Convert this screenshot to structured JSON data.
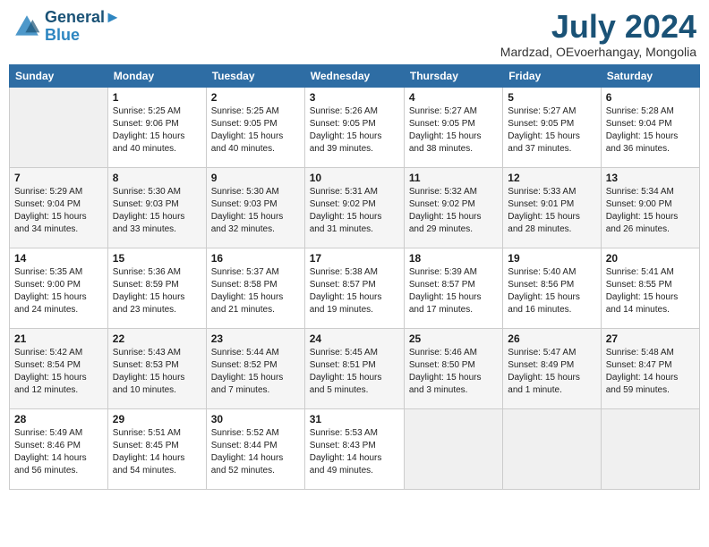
{
  "header": {
    "logo_line1": "General",
    "logo_line2": "Blue",
    "month": "July 2024",
    "location": "Mardzad, OEvoerhangay, Mongolia"
  },
  "weekdays": [
    "Sunday",
    "Monday",
    "Tuesday",
    "Wednesday",
    "Thursday",
    "Friday",
    "Saturday"
  ],
  "weeks": [
    [
      {
        "day": "",
        "empty": true
      },
      {
        "day": "1",
        "sunrise": "5:25 AM",
        "sunset": "9:06 PM",
        "daylight": "15 hours and 40 minutes."
      },
      {
        "day": "2",
        "sunrise": "5:25 AM",
        "sunset": "9:05 PM",
        "daylight": "15 hours and 40 minutes."
      },
      {
        "day": "3",
        "sunrise": "5:26 AM",
        "sunset": "9:05 PM",
        "daylight": "15 hours and 39 minutes."
      },
      {
        "day": "4",
        "sunrise": "5:27 AM",
        "sunset": "9:05 PM",
        "daylight": "15 hours and 38 minutes."
      },
      {
        "day": "5",
        "sunrise": "5:27 AM",
        "sunset": "9:05 PM",
        "daylight": "15 hours and 37 minutes."
      },
      {
        "day": "6",
        "sunrise": "5:28 AM",
        "sunset": "9:04 PM",
        "daylight": "15 hours and 36 minutes."
      }
    ],
    [
      {
        "day": "7",
        "sunrise": "5:29 AM",
        "sunset": "9:04 PM",
        "daylight": "15 hours and 34 minutes."
      },
      {
        "day": "8",
        "sunrise": "5:30 AM",
        "sunset": "9:03 PM",
        "daylight": "15 hours and 33 minutes."
      },
      {
        "day": "9",
        "sunrise": "5:30 AM",
        "sunset": "9:03 PM",
        "daylight": "15 hours and 32 minutes."
      },
      {
        "day": "10",
        "sunrise": "5:31 AM",
        "sunset": "9:02 PM",
        "daylight": "15 hours and 31 minutes."
      },
      {
        "day": "11",
        "sunrise": "5:32 AM",
        "sunset": "9:02 PM",
        "daylight": "15 hours and 29 minutes."
      },
      {
        "day": "12",
        "sunrise": "5:33 AM",
        "sunset": "9:01 PM",
        "daylight": "15 hours and 28 minutes."
      },
      {
        "day": "13",
        "sunrise": "5:34 AM",
        "sunset": "9:00 PM",
        "daylight": "15 hours and 26 minutes."
      }
    ],
    [
      {
        "day": "14",
        "sunrise": "5:35 AM",
        "sunset": "9:00 PM",
        "daylight": "15 hours and 24 minutes."
      },
      {
        "day": "15",
        "sunrise": "5:36 AM",
        "sunset": "8:59 PM",
        "daylight": "15 hours and 23 minutes."
      },
      {
        "day": "16",
        "sunrise": "5:37 AM",
        "sunset": "8:58 PM",
        "daylight": "15 hours and 21 minutes."
      },
      {
        "day": "17",
        "sunrise": "5:38 AM",
        "sunset": "8:57 PM",
        "daylight": "15 hours and 19 minutes."
      },
      {
        "day": "18",
        "sunrise": "5:39 AM",
        "sunset": "8:57 PM",
        "daylight": "15 hours and 17 minutes."
      },
      {
        "day": "19",
        "sunrise": "5:40 AM",
        "sunset": "8:56 PM",
        "daylight": "15 hours and 16 minutes."
      },
      {
        "day": "20",
        "sunrise": "5:41 AM",
        "sunset": "8:55 PM",
        "daylight": "15 hours and 14 minutes."
      }
    ],
    [
      {
        "day": "21",
        "sunrise": "5:42 AM",
        "sunset": "8:54 PM",
        "daylight": "15 hours and 12 minutes."
      },
      {
        "day": "22",
        "sunrise": "5:43 AM",
        "sunset": "8:53 PM",
        "daylight": "15 hours and 10 minutes."
      },
      {
        "day": "23",
        "sunrise": "5:44 AM",
        "sunset": "8:52 PM",
        "daylight": "15 hours and 7 minutes."
      },
      {
        "day": "24",
        "sunrise": "5:45 AM",
        "sunset": "8:51 PM",
        "daylight": "15 hours and 5 minutes."
      },
      {
        "day": "25",
        "sunrise": "5:46 AM",
        "sunset": "8:50 PM",
        "daylight": "15 hours and 3 minutes."
      },
      {
        "day": "26",
        "sunrise": "5:47 AM",
        "sunset": "8:49 PM",
        "daylight": "15 hours and 1 minute."
      },
      {
        "day": "27",
        "sunrise": "5:48 AM",
        "sunset": "8:47 PM",
        "daylight": "14 hours and 59 minutes."
      }
    ],
    [
      {
        "day": "28",
        "sunrise": "5:49 AM",
        "sunset": "8:46 PM",
        "daylight": "14 hours and 56 minutes."
      },
      {
        "day": "29",
        "sunrise": "5:51 AM",
        "sunset": "8:45 PM",
        "daylight": "14 hours and 54 minutes."
      },
      {
        "day": "30",
        "sunrise": "5:52 AM",
        "sunset": "8:44 PM",
        "daylight": "14 hours and 52 minutes."
      },
      {
        "day": "31",
        "sunrise": "5:53 AM",
        "sunset": "8:43 PM",
        "daylight": "14 hours and 49 minutes."
      },
      {
        "day": "",
        "empty": true
      },
      {
        "day": "",
        "empty": true
      },
      {
        "day": "",
        "empty": true
      }
    ]
  ]
}
